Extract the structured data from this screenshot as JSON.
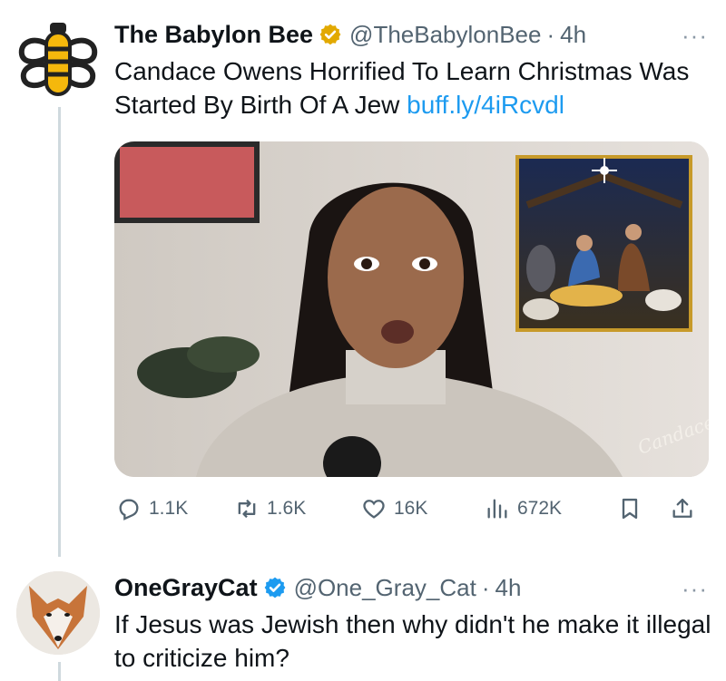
{
  "tweets": [
    {
      "author_name": "The Babylon Bee",
      "handle": "@TheBabylonBee",
      "separator": "·",
      "time": "4h",
      "verified_badge_color": "#e2a900",
      "text": "Candace Owens Horrified To Learn Christmas Was Started By Birth Of A Jew",
      "link": "buff.ly/4iRcvdl",
      "image_signature": "Candace",
      "actions": {
        "replies": "1.1K",
        "retweets": "1.6K",
        "likes": "16K",
        "views": "672K"
      }
    },
    {
      "author_name": "OneGrayCat",
      "handle": "@One_Gray_Cat",
      "separator": "·",
      "time": "4h",
      "verified_badge_color": "#1d9bf0",
      "text": "If Jesus was Jewish then why didn't he make it illegal to criticize him?"
    }
  ],
  "more_label": "···",
  "colors": {
    "text_primary": "#0f1419",
    "text_secondary": "#536471",
    "link": "#1d9bf0",
    "thread_line": "#cfd9de"
  }
}
